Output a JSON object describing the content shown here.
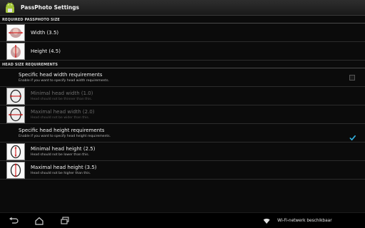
{
  "app": {
    "title": "PassPhoto Settings"
  },
  "sections": {
    "passphoto": {
      "header": "REQUIRED PASSPHOTO SIZE",
      "items": [
        {
          "title": "Width (3.5)"
        },
        {
          "title": "Height (4.5)"
        }
      ]
    },
    "head": {
      "header": "HEAD SIZE REQUIREMENTS",
      "width_check": {
        "title": "Specific head width requirements",
        "summary": "Enable if you want to specify head width requirements.",
        "checked": false
      },
      "width_items": [
        {
          "title": "Minimal head width (1.0)",
          "summary": "Head should not be thinner than this."
        },
        {
          "title": "Maximal head width (2.0)",
          "summary": "Head should not be wider than this."
        }
      ],
      "height_check": {
        "title": "Specific head height requirements",
        "summary": "Enable if you want to specify head height requirements.",
        "checked": true
      },
      "height_items": [
        {
          "title": "Minimal head height (2.5)",
          "summary": "Head should not be lower than this."
        },
        {
          "title": "Maximal head height (3.5)",
          "summary": "Head should not be higher than this."
        }
      ]
    }
  },
  "status": {
    "wifi_text": "Wi-Fi-netwerk beschikbaar"
  },
  "colors": {
    "accent": "#33b5e5",
    "marker_red": "#d42a2a"
  }
}
